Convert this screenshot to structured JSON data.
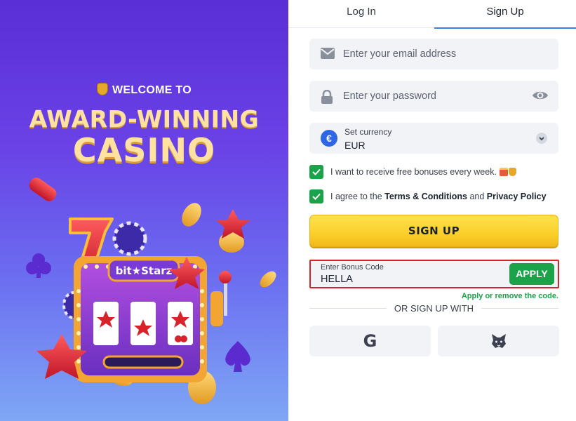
{
  "promo": {
    "welcome": "WELCOME TO",
    "headline_line1": "AWARD-WINNING",
    "headline_line2": "CASINO",
    "machine_logo": "bit★Starz",
    "icons": [
      "money-bag-icon",
      "slot-machine-illustration",
      "lucky-seven-icon",
      "star-icon",
      "coin-icon",
      "club-icon",
      "spade-icon",
      "poker-chip-icon"
    ]
  },
  "tabs": [
    {
      "label": "Log In",
      "active": false
    },
    {
      "label": "Sign Up",
      "active": true
    }
  ],
  "form": {
    "email": {
      "placeholder": "Enter your email address",
      "value": "",
      "icon": "envelope-icon"
    },
    "password": {
      "placeholder": "Enter your password",
      "value": "",
      "icon": "lock-icon",
      "toggle_icon": "eye-icon"
    },
    "currency": {
      "label": "Set currency",
      "value": "EUR",
      "symbol": "€",
      "icon": "chevron-down-icon"
    },
    "bonuses_opt_in": {
      "label": "I want to receive free bonuses every week.",
      "checked": true
    },
    "terms": {
      "prefix": "I agree to the ",
      "terms_link": "Terms & Conditions",
      "and": " and ",
      "privacy_link": "Privacy Policy",
      "checked": true
    },
    "signup_button": "SIGN UP",
    "bonus_code": {
      "label": "Enter Bonus Code",
      "value": "HELLA",
      "apply_button": "APPLY",
      "hint": "Apply or remove the code."
    },
    "divider": "OR SIGN UP WITH",
    "social": [
      {
        "name": "Google",
        "glyph": "G",
        "icon": "google-icon"
      },
      {
        "name": "MetaMask",
        "icon": "metamask-fox-icon"
      }
    ]
  },
  "colors": {
    "promo_bg_top": "#5a2fd6",
    "promo_bg_bottom": "#7ea7f5",
    "headline": "#ffe2a0",
    "tab_active_underline": "#3d7be0",
    "field_bg": "#f1f3f7",
    "checkbox_green": "#1ba34a",
    "signup_yellow": "#fbcf2a",
    "bonus_highlight_border": "#d8232a"
  }
}
